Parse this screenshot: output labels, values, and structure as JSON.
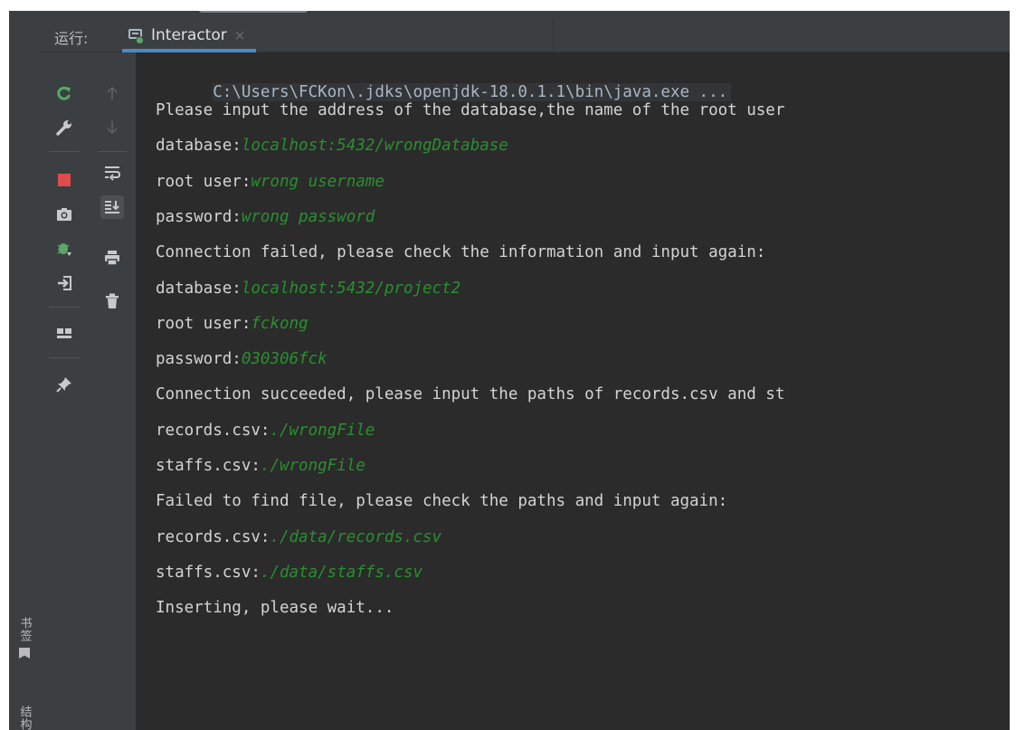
{
  "run_panel": {
    "label": "运行:",
    "tab": {
      "title": "Interactor",
      "close": "×"
    }
  },
  "side_strip": {
    "bookmarks": "书签",
    "structure": "结构"
  },
  "toolbar_left": {
    "colors": {
      "rerun": "#59a869",
      "stop": "#e04b4b",
      "debug": "#59a869"
    },
    "icons": [
      "rerun-icon",
      "wrench-icon",
      "stop-icon",
      "camera-icon",
      "debug-icon",
      "login-icon",
      "layout-icon",
      "pin-icon"
    ]
  },
  "toolbar_right": {
    "icons": [
      "arrow-up-icon",
      "arrow-down-icon",
      "soft-wrap-icon",
      "scroll-to-end-icon",
      "print-icon",
      "trash-icon"
    ]
  },
  "console": {
    "command": "C:\\Users\\FCKon\\.jdks\\openjdk-18.0.1.1\\bin\\java.exe ...",
    "lines": [
      {
        "text": "Please input the address of the database,the name of the root user",
        "input": ""
      },
      {
        "text": "database:",
        "input": "localhost:5432/wrongDatabase"
      },
      {
        "text": "root user:",
        "input": "wrong username"
      },
      {
        "text": "password:",
        "input": "wrong password"
      },
      {
        "text": "Connection failed, please check the information and input again:",
        "input": ""
      },
      {
        "text": "database:",
        "input": "localhost:5432/project2"
      },
      {
        "text": "root user:",
        "input": "fckong"
      },
      {
        "text": "password:",
        "input": "030306fck"
      },
      {
        "text": "Connection succeeded, please input the paths of records.csv and st",
        "input": ""
      },
      {
        "text": "records.csv:",
        "input": "./wrongFile"
      },
      {
        "text": "staffs.csv:",
        "input": "./wrongFile"
      },
      {
        "text": "Failed to find file, please check the paths and input again:",
        "input": ""
      },
      {
        "text": "records.csv:",
        "input": "./data/records.csv"
      },
      {
        "text": "staffs.csv:",
        "input": "./data/staffs.csv"
      },
      {
        "text": "Inserting, please wait...",
        "input": ""
      }
    ],
    "colors": {
      "output": "#d4d4d4",
      "user_input": "#2a8f2f"
    }
  }
}
